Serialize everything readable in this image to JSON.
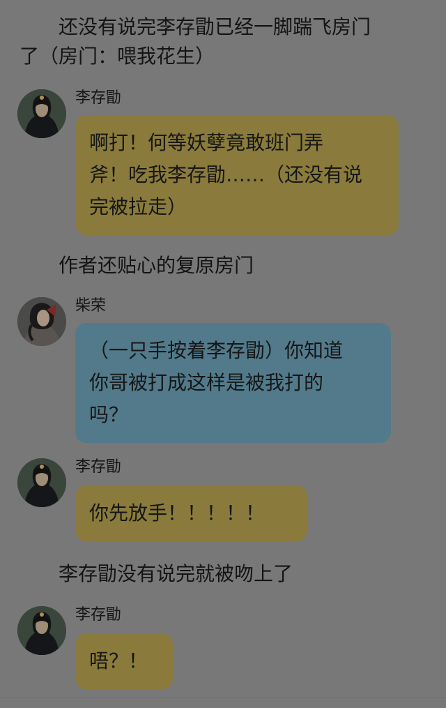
{
  "thread": {
    "narration_1": {
      "line_1": "　　还没有说完李存勖已经一脚踹飞房门",
      "line_2": "了（房门：喂我花生）"
    },
    "message_1": {
      "sender": "李存勖",
      "avatar_icon": "character-portrait-icon",
      "line_1": "啊打！何等妖孽竟敢班门弄",
      "line_2": "斧！吃我李存勖……（还没有说",
      "line_3": "完被拉走）",
      "bubble_color": "#8a7b3c"
    },
    "narration_2": {
      "line_1": "　　作者还贴心的复原房门"
    },
    "message_2": {
      "sender": "柴荣",
      "avatar_icon": "character-portrait-icon",
      "line_1": "（一只手按着李存勖）你知道",
      "line_2": "你哥被打成这样是被我打的",
      "line_3": "吗？",
      "bubble_color": "#527a8a"
    },
    "message_3": {
      "sender": "李存勖",
      "avatar_icon": "character-portrait-icon",
      "line_1": "你先放手！！！！！",
      "bubble_color": "#8a7b3c"
    },
    "narration_3": {
      "line_1": "　　李存勖没有说完就被吻上了"
    },
    "message_4": {
      "sender": "李存勖",
      "avatar_icon": "character-portrait-icon",
      "line_1": "唔？！",
      "bubble_color": "#8a7b3c"
    }
  },
  "colors": {
    "background": "#787878",
    "yellow_bubble": "#8a7b3c",
    "blue_bubble": "#527a8a"
  }
}
